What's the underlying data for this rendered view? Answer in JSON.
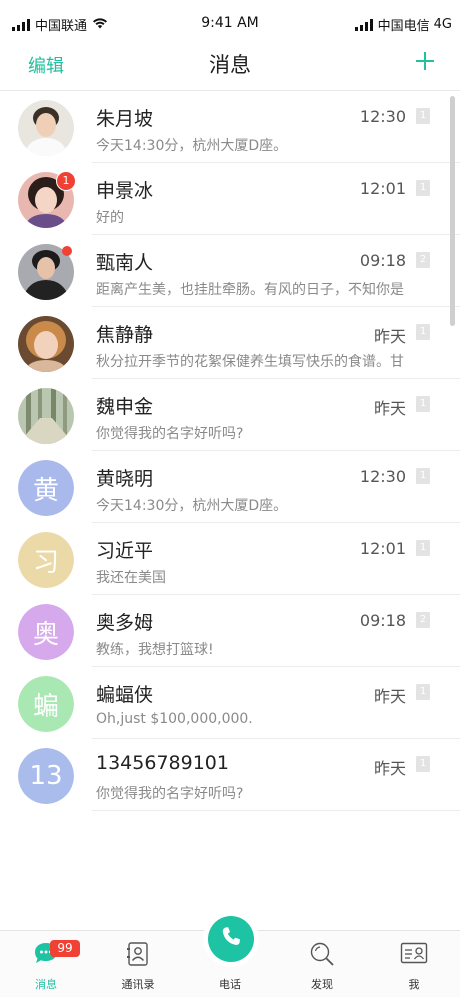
{
  "status_bar": {
    "left_carrier": "中国联通",
    "time": "9:41 AM",
    "right_carrier": "中国电信",
    "network": "4G"
  },
  "header": {
    "left_label": "编辑",
    "title": "消息",
    "right_icon": "plus-icon"
  },
  "conversations": [
    {
      "name": "朱月坡",
      "message": "今天14:30分，杭州大厦D座。",
      "time": "12:30",
      "tag": "1",
      "avatar_type": "photo",
      "avatar_text": ""
    },
    {
      "name": "申景冰",
      "message": "好的",
      "time": "12:01",
      "tag": "1",
      "avatar_type": "photo",
      "avatar_text": "",
      "unread": "1"
    },
    {
      "name": "甄南人",
      "message": "距离产生美，也挂肚牵肠。有风的日子，不知你是",
      "time": "09:18",
      "tag": "2",
      "avatar_type": "photo",
      "avatar_text": "",
      "dot": true
    },
    {
      "name": "焦静静",
      "message": "秋分拉开季节的花絮保健养生填写快乐的食谱。甘",
      "time": "昨天",
      "tag": "1",
      "avatar_type": "photo",
      "avatar_text": ""
    },
    {
      "name": "魏申金",
      "message": "你觉得我的名字好听吗?",
      "time": "昨天",
      "tag": "1",
      "avatar_type": "photo",
      "avatar_text": ""
    },
    {
      "name": "黄晓明",
      "message": "今天14:30分，杭州大厦D座。",
      "time": "12:30",
      "tag": "1",
      "avatar_type": "text",
      "avatar_text": "黄",
      "avatar_color": "#a9b9ec"
    },
    {
      "name": "习近平",
      "message": "我还在美国",
      "time": "12:01",
      "tag": "1",
      "avatar_type": "text",
      "avatar_text": "习",
      "avatar_color": "#ecd9a8"
    },
    {
      "name": "奥多姆",
      "message": "教练，我想打篮球!",
      "time": "09:18",
      "tag": "2",
      "avatar_type": "text",
      "avatar_text": "奥",
      "avatar_color": "#d6a9ec"
    },
    {
      "name": "蝙蝠侠",
      "message": "Oh,just $100,000,000.",
      "time": "昨天",
      "tag": "1",
      "avatar_type": "text",
      "avatar_text": "蝙",
      "avatar_color": "#a9e8b3"
    },
    {
      "name": "13456789101",
      "message": "你觉得我的名字好听吗?",
      "time": "昨天",
      "tag": "1",
      "avatar_type": "text",
      "avatar_text": "13",
      "avatar_color": "#a9bcec"
    }
  ],
  "tabs": [
    {
      "label": "消息",
      "icon": "chat-icon",
      "active": true,
      "badge": "99"
    },
    {
      "label": "通讯录",
      "icon": "contacts-icon",
      "active": false
    },
    {
      "label": "电话",
      "icon": "phone-icon",
      "active": false
    },
    {
      "label": "发现",
      "icon": "discover-icon",
      "active": false
    },
    {
      "label": "我",
      "icon": "profile-card-icon",
      "active": false
    }
  ],
  "colors": {
    "accent": "#1dc3a2",
    "badge": "#ef4134"
  }
}
